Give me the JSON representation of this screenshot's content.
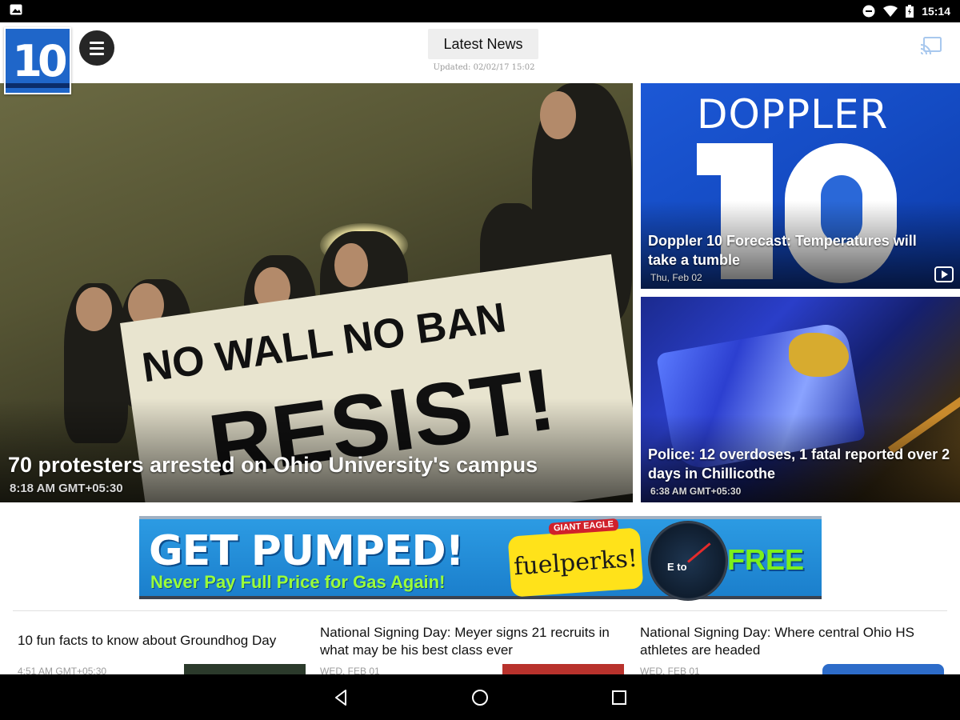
{
  "status_bar": {
    "time": "15:14",
    "icons": [
      "image-notification-icon",
      "do-not-disturb-icon",
      "wifi-icon",
      "battery-icon"
    ]
  },
  "app_bar": {
    "logo_text": "10",
    "title": "Latest News",
    "updated": "Updated: 02/02/17 15:02",
    "icons": [
      "menu-icon",
      "cast-icon"
    ]
  },
  "hero": {
    "headline": "70 protesters arrested on Ohio University's campus",
    "time": "8:18 AM GMT+05:30",
    "banner_line1": "NO WALL NO BAN",
    "banner_line2": "RESIST!"
  },
  "side_cards": [
    {
      "headline": "Doppler 10 Forecast: Temperatures will take a tumble",
      "time": "Thu, Feb 02",
      "image_word": "DOPPLER",
      "icon": "video-icon"
    },
    {
      "headline": "Police: 12 overdoses, 1 fatal reported over 2 days in Chillicothe",
      "time": "6:38 AM GMT+05:30"
    }
  ],
  "ad": {
    "headline": "GET PUMPED!",
    "subline": "Never Pay Full Price for Gas Again!",
    "brand": "GIANT EAGLE",
    "tag": "fuelperks!",
    "gauge_text": "E  to",
    "free": "FREE",
    "colors": {
      "background": "#1f8ad5",
      "accent": "#9bff3a",
      "tag": "#ffe21a"
    }
  },
  "articles": [
    {
      "title": "10 fun facts to know about Groundhog Day",
      "time": "4:51 AM GMT+05:30"
    },
    {
      "title": "National Signing Day: Meyer signs 21 recruits in what may be his best class ever",
      "time": "WED, FEB 01"
    },
    {
      "title": "National Signing Day: Where central Ohio HS athletes are headed",
      "time": "WED, FEB 01"
    }
  ],
  "nav_bar": {
    "icons": [
      "back-icon",
      "home-icon",
      "recents-icon"
    ]
  }
}
